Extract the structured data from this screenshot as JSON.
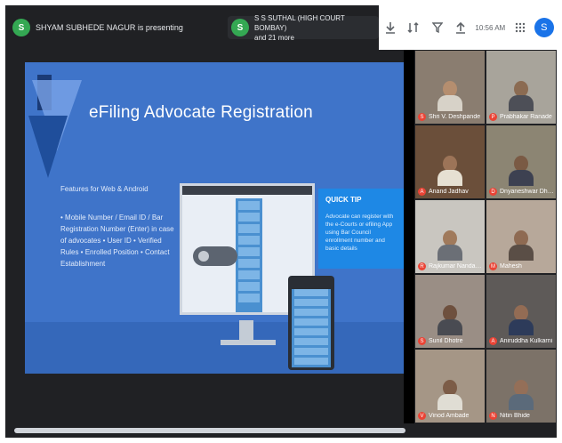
{
  "topbar": {
    "presenter_initial": "S",
    "presenter_label": "SHYAM SUBHEDE NAGUR is presenting",
    "second_initial": "S",
    "second_line1": "S S SUTHAL (HIGH COURT BOMBAY)",
    "second_line2": "and 21 more",
    "time_label": "10:56 AM",
    "account_initial": "S"
  },
  "slide": {
    "title": "eFiling Advocate Registration",
    "subhead": "Features for Web & Android",
    "body": "• Mobile Number / Email ID / Bar Registration Number (Enter) in case of advocates • User ID • Verified Rules • Enrolled Position • Contact Establishment",
    "quick_tip_title": "QUICK TIP",
    "quick_tip_body": "Advocate can register with the e-Courts or efiling App using Bar Council enrollment number and basic details"
  },
  "participants": [
    {
      "name": "Shri V. Deshpande",
      "initial": "S",
      "bg": "#8a7d70",
      "skin": "#b58e6f",
      "shirt": "#d7d2c8"
    },
    {
      "name": "Prabhakar Ranade",
      "initial": "P",
      "bg": "#a8a49b",
      "skin": "#8b6b52",
      "shirt": "#4d4f57"
    },
    {
      "name": "Anand Jadhav",
      "initial": "A",
      "bg": "#6b4f3a",
      "skin": "#9c7458",
      "shirt": "#e6e0d2"
    },
    {
      "name": "Dnyaneshwar Dharmadhikari",
      "initial": "D",
      "bg": "#8c8573",
      "skin": "#7a5a44",
      "shirt": "#3d4151"
    },
    {
      "name": "Rajkumar Nandanwar",
      "initial": "R",
      "bg": "#c9c6c0",
      "skin": "#a07a5c",
      "shirt": "#6b6f76"
    },
    {
      "name": "Mahesh",
      "initial": "M",
      "bg": "#b7a89a",
      "skin": "#8e6a52",
      "shirt": "#5a4e46"
    },
    {
      "name": "Sunil Dhotre",
      "initial": "S",
      "bg": "#9a8e85",
      "skin": "#6e503e",
      "shirt": "#494b52"
    },
    {
      "name": "Aniruddha Kulkarni",
      "initial": "A",
      "bg": "#5e5a58",
      "skin": "#936c54",
      "shirt": "#2d3b5a"
    },
    {
      "name": "Vinod Ambade",
      "initial": "V",
      "bg": "#a59686",
      "skin": "#7c5c47",
      "shirt": "#e0ddd4"
    },
    {
      "name": "Nitin Bhide",
      "initial": "N",
      "bg": "#7c7268",
      "skin": "#946f58",
      "shirt": "#5b6a7a"
    }
  ]
}
